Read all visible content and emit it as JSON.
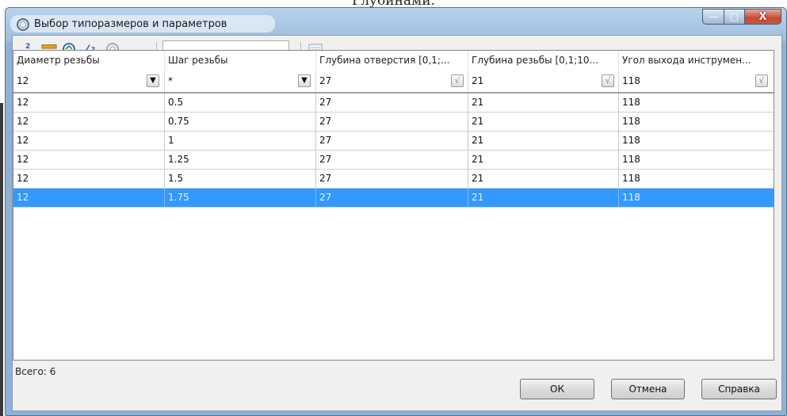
{
  "background_caption": "Глубинами.",
  "window": {
    "title": "Выбор типоразмеров и параметров",
    "controls": {
      "minimize": "—",
      "maximize": "□",
      "close": "X"
    }
  },
  "toolbar": {
    "icons": [
      "parameter-distance-icon",
      "parameter-ruler-icon",
      "refresh-globe-icon",
      "angle-question-icon",
      "disabled-cycle-icon",
      "table-view-icon"
    ],
    "search_value": ""
  },
  "grid": {
    "columns": [
      "Диаметр резьбы",
      "Шаг резьбы",
      "Глубина отверстия [0,1;...",
      "Глубина резьбы [0,1;10...",
      "Угол выхода инструмен..."
    ],
    "filters": [
      "12",
      "*",
      "27",
      "21",
      "118"
    ],
    "filter_buttons": [
      "▼",
      "▼",
      "√",
      "√",
      "√"
    ],
    "rows": [
      [
        "12",
        "0.5",
        "27",
        "21",
        "118"
      ],
      [
        "12",
        "0.75",
        "27",
        "21",
        "118"
      ],
      [
        "12",
        "1",
        "27",
        "21",
        "118"
      ],
      [
        "12",
        "1.25",
        "27",
        "21",
        "118"
      ],
      [
        "12",
        "1.5",
        "27",
        "21",
        "118"
      ],
      [
        "12",
        "1.75",
        "27",
        "21",
        "118"
      ]
    ],
    "selected_row": 5
  },
  "footer": {
    "total_label": "Всего: 6",
    "ok_label": "ОК",
    "cancel_label": "Отмена",
    "help_label": "Справка"
  },
  "colors": {
    "selection": "#3399ff",
    "titlebar": "#9dbfe0",
    "close_button": "#c44b35"
  }
}
